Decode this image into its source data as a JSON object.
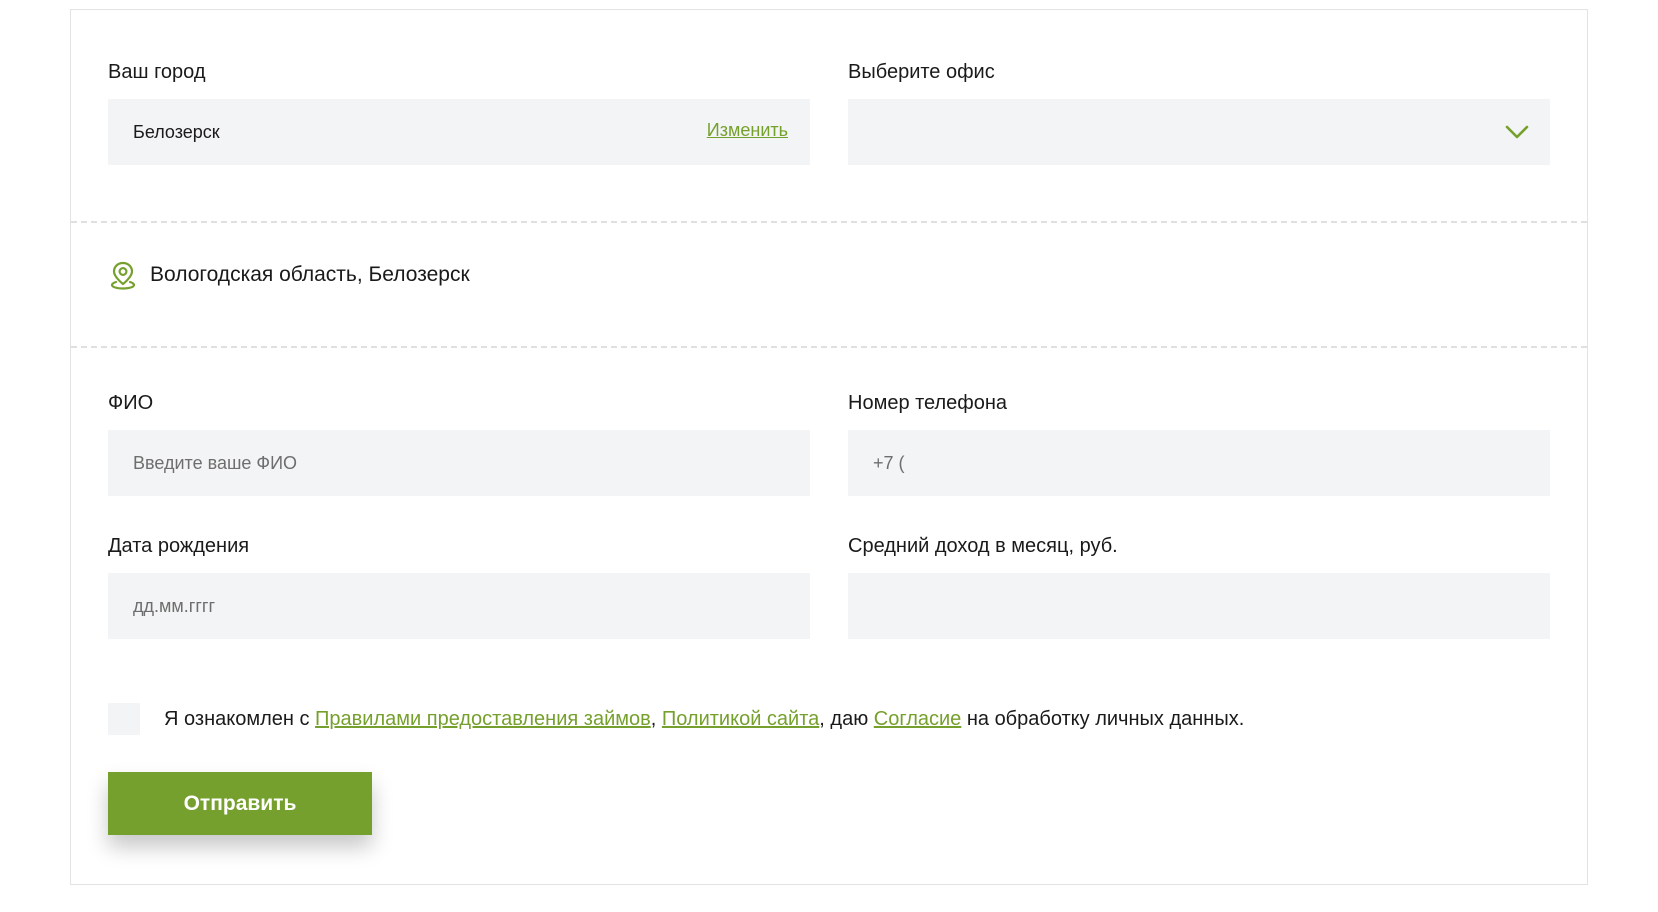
{
  "colors": {
    "accent": "#76a02d",
    "field_bg": "#f3f4f5",
    "text": "#1a1a1a",
    "placeholder": "#6e6e6e",
    "border": "#e3e3e3"
  },
  "city_field": {
    "label": "Ваш город",
    "value": "Белозерск",
    "change_link": "Изменить"
  },
  "office_field": {
    "label": "Выберите офис",
    "value": "",
    "icon": "chevron-down-icon"
  },
  "location": {
    "icon": "map-pin-icon",
    "text": "Вологодская область, Белозерск"
  },
  "name_field": {
    "label": "ФИО",
    "placeholder": "Введите ваше ФИО",
    "value": ""
  },
  "phone_field": {
    "label": "Номер телефона",
    "placeholder": "+7 (",
    "value": ""
  },
  "birth_field": {
    "label": "Дата рождения",
    "placeholder": "дд.мм.гггг",
    "value": ""
  },
  "income_field": {
    "label": "Средний доход в месяц, руб.",
    "placeholder": "",
    "value": ""
  },
  "consent": {
    "checked": false,
    "text_before": "Я ознакомлен с ",
    "link_rules": "Правилами предоставления займов",
    "separator": ", ",
    "link_policy": "Политикой сайта",
    "text_middle": ", даю ",
    "link_agreement": "Согласие",
    "text_after": " на обработку личных данных."
  },
  "submit": {
    "label": "Отправить"
  }
}
